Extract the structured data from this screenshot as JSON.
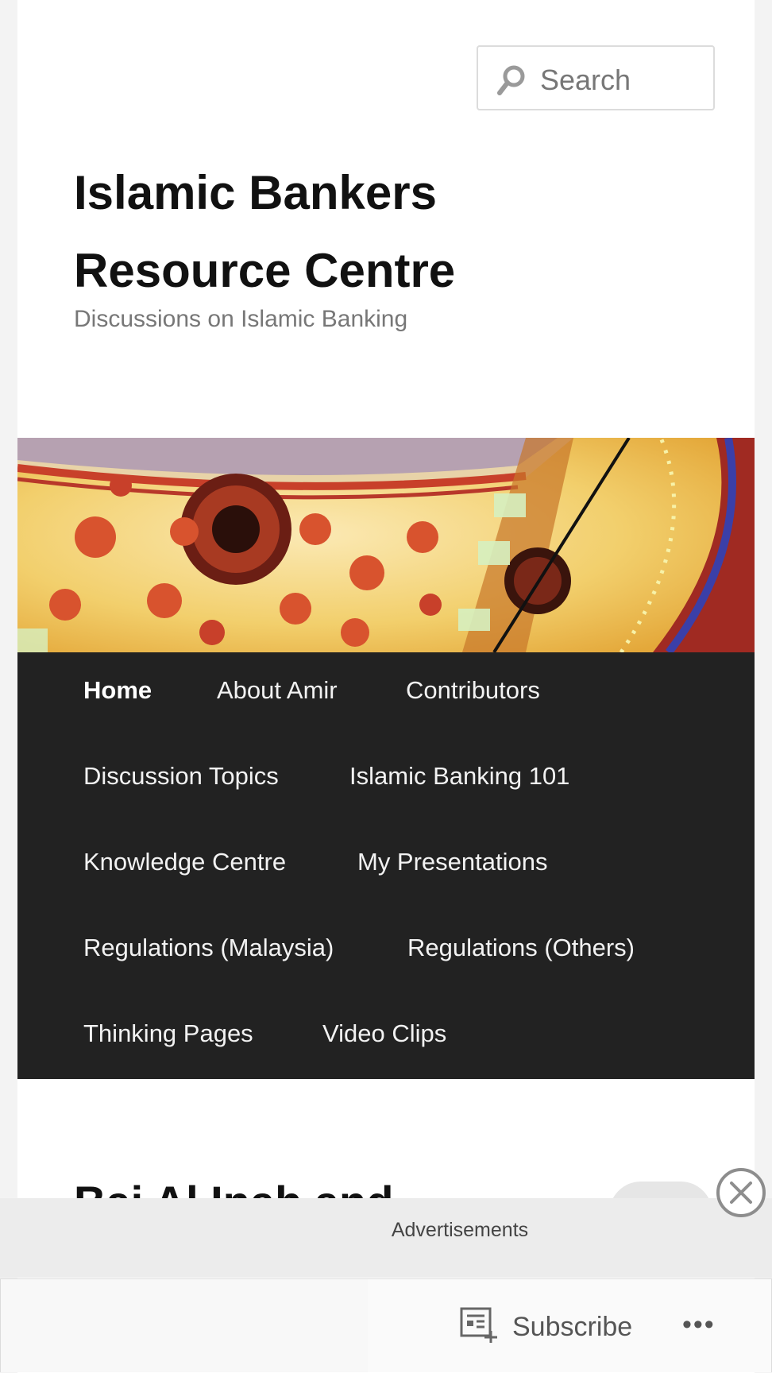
{
  "search": {
    "placeholder": "Search"
  },
  "site": {
    "title": "Islamic Bankers Resource Centre",
    "tagline": "Discussions on Islamic Banking"
  },
  "nav": {
    "items": [
      {
        "label": "Home",
        "active": true
      },
      {
        "label": "About Amir"
      },
      {
        "label": "Contributors"
      },
      {
        "label": "Discussion Topics"
      },
      {
        "label": "Islamic Banking 101"
      },
      {
        "label": "Knowledge Centre"
      },
      {
        "label": "My Presentations"
      },
      {
        "label": "Regulations (Malaysia)"
      },
      {
        "label": "Regulations (Others)"
      },
      {
        "label": "Thinking Pages"
      },
      {
        "label": "Video Clips"
      }
    ]
  },
  "post": {
    "title_partial": "Bai Al Inah and"
  },
  "ad": {
    "label": "Advertisements"
  },
  "bottom_bar": {
    "subscribe_label": "Subscribe",
    "more_label": "•••"
  },
  "colors": {
    "nav_background": "#222222",
    "page_background": "#ffffff",
    "outer_background": "#f3f3f3",
    "tagline": "#777777"
  },
  "icons": [
    "search-icon",
    "close-icon",
    "subscribe-icon",
    "more-icon",
    "comment-bubble-icon"
  ]
}
